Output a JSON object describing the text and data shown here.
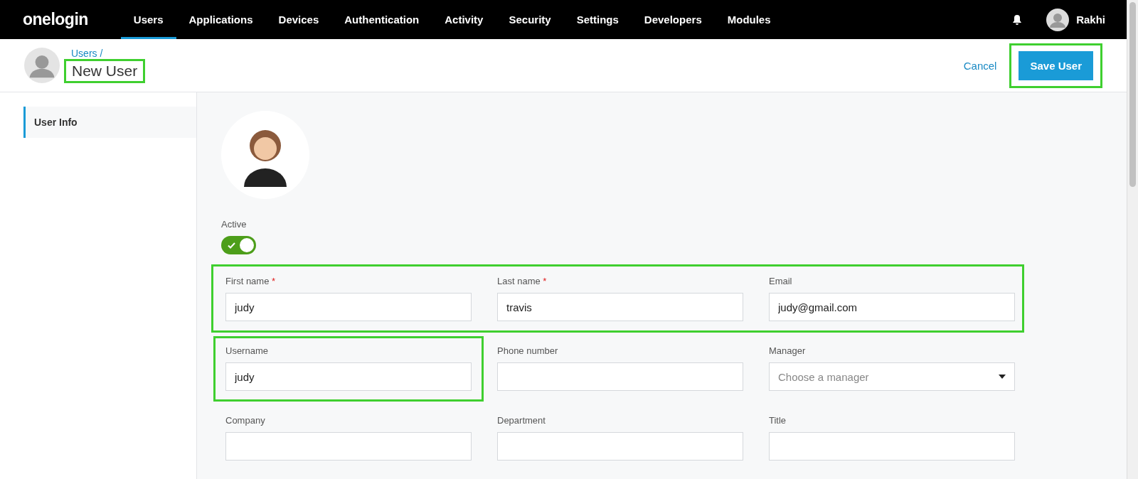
{
  "nav": {
    "logo": "onelogin",
    "items": [
      {
        "label": "Users",
        "selected": true
      },
      {
        "label": "Applications",
        "selected": false
      },
      {
        "label": "Devices",
        "selected": false
      },
      {
        "label": "Authentication",
        "selected": false
      },
      {
        "label": "Activity",
        "selected": false
      },
      {
        "label": "Security",
        "selected": false
      },
      {
        "label": "Settings",
        "selected": false
      },
      {
        "label": "Developers",
        "selected": false
      },
      {
        "label": "Modules",
        "selected": false
      }
    ],
    "user": "Rakhi"
  },
  "header": {
    "breadcrumb": "Users /",
    "title": "New User",
    "title_highlighted": true,
    "cancel": "Cancel",
    "save": "Save User",
    "save_highlighted": true
  },
  "sidebar": {
    "items": [
      {
        "label": "User Info",
        "selected": true
      }
    ]
  },
  "form": {
    "active": {
      "label": "Active",
      "on": true
    },
    "rows": [
      {
        "highlighted": true,
        "fields": [
          {
            "label": "First name",
            "required_mark": "*",
            "value": "judy",
            "highlighted": false
          },
          {
            "label": "Last name",
            "required_mark": "*",
            "value": "travis",
            "highlighted": false
          },
          {
            "label": "Email",
            "value": "judy@gmail.com",
            "highlighted": false
          }
        ]
      },
      {
        "highlighted": false,
        "fields": [
          {
            "label": "Username",
            "value": "judy",
            "highlighted": true
          },
          {
            "label": "Phone number",
            "highlighted": false
          },
          {
            "label": "Manager",
            "kind": "select",
            "placeholder": "Choose a manager",
            "highlighted": false
          }
        ]
      },
      {
        "highlighted": false,
        "fields": [
          {
            "label": "Company",
            "highlighted": false
          },
          {
            "label": "Department",
            "highlighted": false
          },
          {
            "label": "Title",
            "highlighted": false
          }
        ]
      }
    ]
  }
}
